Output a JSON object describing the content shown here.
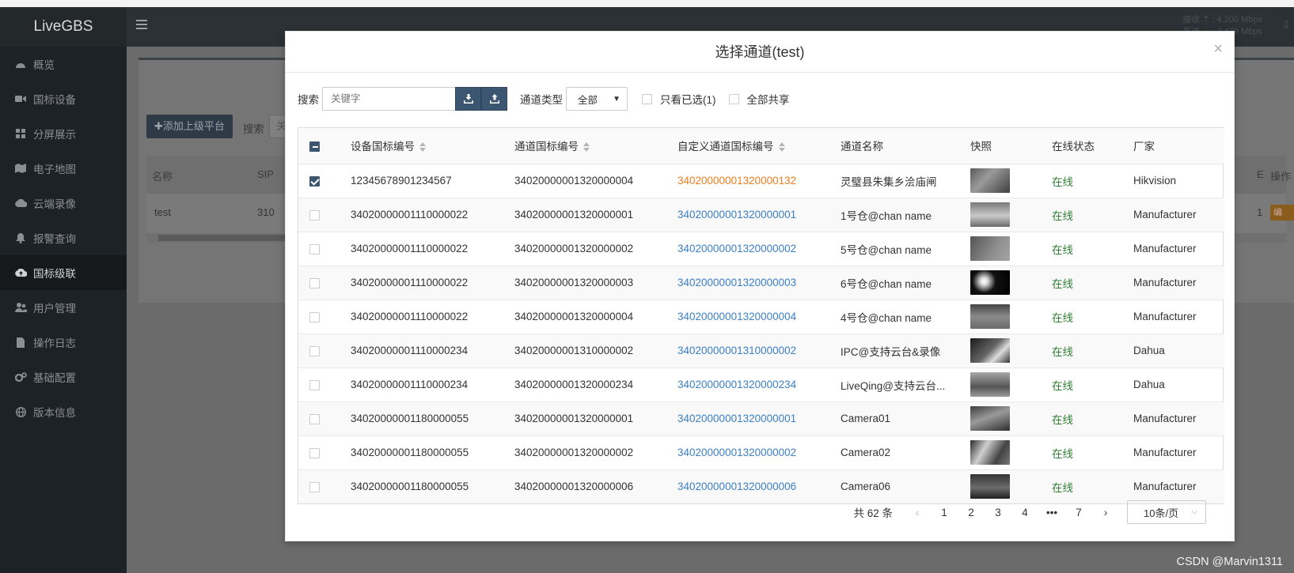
{
  "app": {
    "logo": "LiveGBS",
    "traffic_rx": "接收 ⇡ : 4.200 Mbps",
    "traffic_tx": "发送 ⇣ : 2.479 Mbps"
  },
  "sidebar": {
    "items": [
      {
        "label": "概览",
        "icon": "dashboard-icon"
      },
      {
        "label": "国标设备",
        "icon": "video-camera-icon"
      },
      {
        "label": "分屏展示",
        "icon": "grid-icon"
      },
      {
        "label": "电子地图",
        "icon": "map-icon"
      },
      {
        "label": "云端录像",
        "icon": "cloud-icon"
      },
      {
        "label": "报警查询",
        "icon": "bell-icon"
      },
      {
        "label": "国标级联",
        "icon": "cloud-upload-icon",
        "active": true
      },
      {
        "label": "用户管理",
        "icon": "users-icon"
      },
      {
        "label": "操作日志",
        "icon": "file-icon"
      },
      {
        "label": "基础配置",
        "icon": "gears-icon"
      },
      {
        "label": "版本信息",
        "icon": "globe-icon"
      }
    ]
  },
  "background": {
    "add_button": "✚添加上级平台",
    "search_label": "搜索",
    "search_value": "关",
    "col_name": "名称",
    "col_sip": "SIP",
    "col_e": "E",
    "col_action": "操作",
    "row_name": "test",
    "row_sip": "310",
    "row_e": "1",
    "edit_button": "编"
  },
  "modal": {
    "title": "选择通道(test)",
    "close": "×",
    "search_label": "搜索",
    "search_placeholder": "关键字",
    "channel_type_label": "通道类型",
    "channel_type_value": "全部",
    "only_selected_label": "只看已选(1)",
    "share_all_label": "全部共享",
    "columns": [
      "设备国标编号",
      "通道国标编号",
      "自定义通道国标编号",
      "通道名称",
      "快照",
      "在线状态",
      "厂家"
    ],
    "rows": [
      {
        "checked": true,
        "device_id": "12345678901234567",
        "channel_id": "34020000001320000004",
        "custom_id": "34020000001320000132",
        "custom_color": "orange",
        "name": "灵璧县朱集乡浍庙闸",
        "status": "在线",
        "vendor": "Hikvision",
        "thumb": "thumb-1"
      },
      {
        "checked": false,
        "device_id": "34020000001110000022",
        "channel_id": "34020000001320000001",
        "custom_id": "34020000001320000001",
        "custom_color": "blue",
        "name": "1号仓@chan name",
        "status": "在线",
        "vendor": "Manufacturer",
        "thumb": "thumb-2"
      },
      {
        "checked": false,
        "device_id": "34020000001110000022",
        "channel_id": "34020000001320000002",
        "custom_id": "34020000001320000002",
        "custom_color": "blue",
        "name": "5号仓@chan name",
        "status": "在线",
        "vendor": "Manufacturer",
        "thumb": "thumb-3"
      },
      {
        "checked": false,
        "device_id": "34020000001110000022",
        "channel_id": "34020000001320000003",
        "custom_id": "34020000001320000003",
        "custom_color": "blue",
        "name": "6号仓@chan name",
        "status": "在线",
        "vendor": "Manufacturer",
        "thumb": "thumb-4"
      },
      {
        "checked": false,
        "device_id": "34020000001110000022",
        "channel_id": "34020000001320000004",
        "custom_id": "34020000001320000004",
        "custom_color": "blue",
        "name": "4号仓@chan name",
        "status": "在线",
        "vendor": "Manufacturer",
        "thumb": "thumb-5"
      },
      {
        "checked": false,
        "device_id": "34020000001110000234",
        "channel_id": "34020000001310000002",
        "custom_id": "34020000001310000002",
        "custom_color": "blue",
        "name": "IPC@支持云台&录像",
        "status": "在线",
        "vendor": "Dahua",
        "thumb": "thumb-6"
      },
      {
        "checked": false,
        "device_id": "34020000001110000234",
        "channel_id": "34020000001320000234",
        "custom_id": "34020000001320000234",
        "custom_color": "blue",
        "name": "LiveQing@支持云台...",
        "status": "在线",
        "vendor": "Dahua",
        "thumb": "thumb-7"
      },
      {
        "checked": false,
        "device_id": "34020000001180000055",
        "channel_id": "34020000001320000001",
        "custom_id": "34020000001320000001",
        "custom_color": "blue",
        "name": "Camera01",
        "status": "在线",
        "vendor": "Manufacturer",
        "thumb": "thumb-8"
      },
      {
        "checked": false,
        "device_id": "34020000001180000055",
        "channel_id": "34020000001320000002",
        "custom_id": "34020000001320000002",
        "custom_color": "blue",
        "name": "Camera02",
        "status": "在线",
        "vendor": "Manufacturer",
        "thumb": "thumb-9"
      },
      {
        "checked": false,
        "device_id": "34020000001180000055",
        "channel_id": "34020000001320000006",
        "custom_id": "34020000001320000006",
        "custom_color": "blue",
        "name": "Camera06",
        "status": "在线",
        "vendor": "Manufacturer",
        "thumb": "thumb-10"
      }
    ],
    "pagination": {
      "total": "共 62 条",
      "prev": "‹",
      "pages": [
        "1",
        "2",
        "3",
        "4",
        "•••",
        "7"
      ],
      "current_page": "2",
      "next": "›",
      "page_size": "10条/页"
    }
  },
  "watermark": "CSDN @Marvin1311",
  "colors": {
    "link_blue": "#3b7fc4",
    "link_orange": "#f07c1a",
    "online_green": "#2e7d32",
    "primary_dark": "#3c5570"
  }
}
